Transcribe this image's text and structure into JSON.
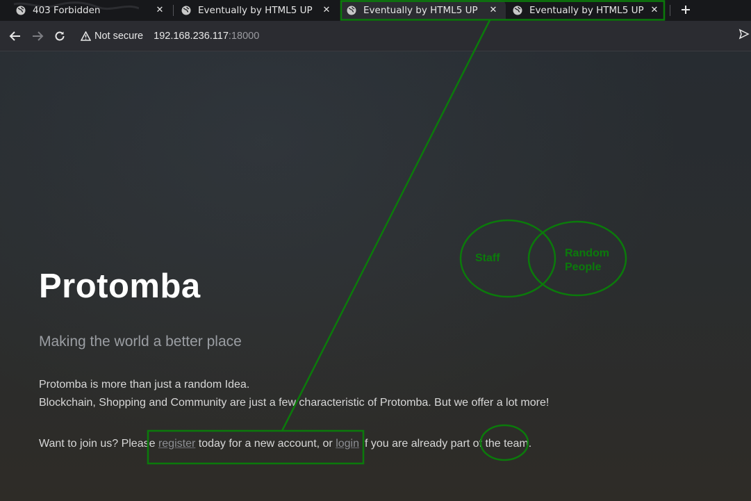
{
  "browser": {
    "tabs": [
      {
        "title": "403 Forbidden",
        "active": false
      },
      {
        "title": "Eventually by HTML5 UP",
        "active": false
      },
      {
        "title": "Eventually by HTML5 UP",
        "active": true
      },
      {
        "title": "Eventually by HTML5 UP",
        "active": false
      }
    ],
    "new_tab_icon": "plus-icon",
    "security_label": "Not secure",
    "url_host": "192.168.236.117",
    "url_port": ":18000"
  },
  "page": {
    "title": "Protomba",
    "subtitle": "Making the world a better place",
    "paragraph_1": "Protomba is more than just a random Idea.",
    "paragraph_2": "Blockchain, Shopping and Community are just a few characteristic of Protomba. But we offer a lot more!",
    "paragraph_3_before": "Want to join us? Please ",
    "register_link": "register",
    "paragraph_3_middle": " today for a new account, or ",
    "login_link": "login",
    "paragraph_3_after": " if you are already part of the team."
  },
  "annotations": {
    "color": "#0b7a0b",
    "venn_left_label": "Staff",
    "venn_right_label_line1": "Random",
    "venn_right_label_line2": "People"
  },
  "colors": {
    "tabstrip": "#17181b",
    "toolbar": "#2b2c31",
    "title": "#ffffff",
    "subtitle": "#9b9ea3",
    "link": "#8d8f94"
  }
}
